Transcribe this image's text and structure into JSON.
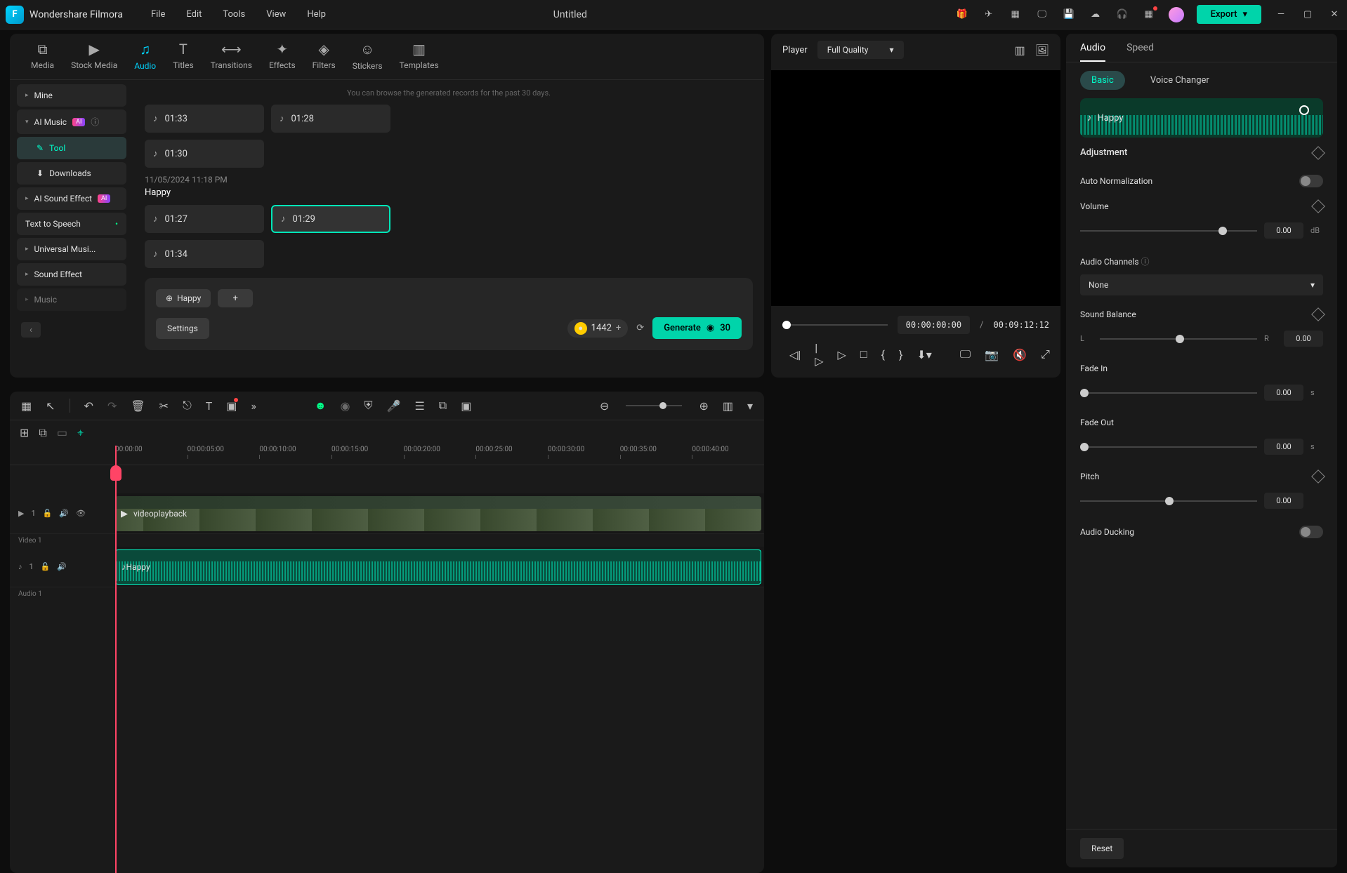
{
  "app": {
    "name": "Wondershare Filmora",
    "document_title": "Untitled"
  },
  "menubar": [
    "File",
    "Edit",
    "Tools",
    "View",
    "Help"
  ],
  "export_label": "Export",
  "media_tabs": [
    "Media",
    "Stock Media",
    "Audio",
    "Titles",
    "Transitions",
    "Effects",
    "Filters",
    "Stickers",
    "Templates"
  ],
  "media_tabs_active": "Audio",
  "sidebar": {
    "items": [
      {
        "label": "Mine",
        "caret": true
      },
      {
        "label": "AI Music",
        "caret": true,
        "ai": true,
        "info": true
      },
      {
        "label": "Tool",
        "indent": true,
        "selected": true
      },
      {
        "label": "Downloads",
        "indent": true
      },
      {
        "label": "AI Sound Effect",
        "caret": true,
        "ai": true
      },
      {
        "label": "Text to Speech",
        "dot": true
      },
      {
        "label": "Universal Musi...",
        "caret": true
      },
      {
        "label": "Sound Effect",
        "caret": true
      },
      {
        "label": "Music",
        "caret": true
      }
    ]
  },
  "content": {
    "hint": "You can browse the generated records for the past 30 days.",
    "top_clips": [
      "01:33",
      "01:28",
      "01:30"
    ],
    "date": "11/05/2024 11:18 PM",
    "section_title": "Happy",
    "mid_clips": [
      "01:27",
      "01:29",
      "01:34"
    ],
    "selected_clip": "01:29",
    "tag": "Happy",
    "settings_label": "Settings",
    "credits": "1442",
    "generate_label": "Generate",
    "generate_cost": "30"
  },
  "player": {
    "label": "Player",
    "quality": "Full Quality",
    "current_time": "00:00:00:00",
    "total_time": "00:09:12:12"
  },
  "timeline": {
    "ruler": [
      "00:00:00",
      "00:00:05:00",
      "00:00:10:00",
      "00:00:15:00",
      "00:00:20:00",
      "00:00:25:00",
      "00:00:30:00",
      "00:00:35:00",
      "00:00:40:00"
    ],
    "video_track_label": "Video 1",
    "audio_track_label": "Audio 1",
    "video_clip_name": "videoplayback",
    "audio_clip_name": "Happy"
  },
  "right_panel": {
    "tabs": [
      "Audio",
      "Speed"
    ],
    "active_tab": "Audio",
    "subtabs": [
      "Basic",
      "Voice Changer"
    ],
    "active_subtab": "Basic",
    "clip_name": "Happy",
    "adjustment_label": "Adjustment",
    "auto_norm_label": "Auto Normalization",
    "volume_label": "Volume",
    "volume_value": "0.00",
    "volume_unit": "dB",
    "channels_label": "Audio Channels",
    "channels_value": "None",
    "balance_label": "Sound Balance",
    "balance_left": "L",
    "balance_right": "R",
    "balance_value": "0.00",
    "fadein_label": "Fade In",
    "fadein_value": "0.00",
    "fadein_unit": "s",
    "fadeout_label": "Fade Out",
    "fadeout_value": "0.00",
    "fadeout_unit": "s",
    "pitch_label": "Pitch",
    "pitch_value": "0.00",
    "ducking_label": "Audio Ducking",
    "reset_label": "Reset"
  }
}
